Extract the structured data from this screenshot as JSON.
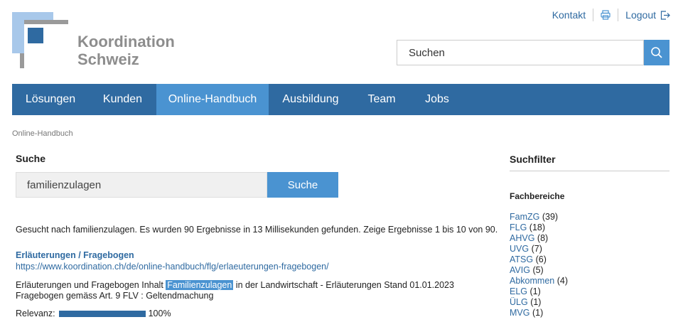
{
  "header": {
    "logo_line1": "Koordination",
    "logo_line2": "Schweiz",
    "links": {
      "kontakt": "Kontakt",
      "logout": "Logout"
    },
    "search_placeholder": "Suchen"
  },
  "nav": {
    "items": [
      {
        "label": "Lösungen",
        "active": false
      },
      {
        "label": "Kunden",
        "active": false
      },
      {
        "label": "Online-Handbuch",
        "active": true
      },
      {
        "label": "Ausbildung",
        "active": false
      },
      {
        "label": "Team",
        "active": false
      },
      {
        "label": "Jobs",
        "active": false
      }
    ]
  },
  "breadcrumb": "Online-Handbuch",
  "search": {
    "heading": "Suche",
    "query": "familienzulagen",
    "button": "Suche",
    "summary": "Gesucht nach familienzulagen. Es wurden 90 Ergebnisse in 13 Millisekunden gefunden. Zeige Ergebnisse 1 bis 10 von 90."
  },
  "results": [
    {
      "title": "Erläuterungen / Fragebogen",
      "url": "https://www.koordination.ch/de/online-handbuch/flg/erlaeuterungen-fragebogen/",
      "snippet_before": "Erläuterungen und Fragebogen Inhalt ",
      "snippet_highlight": "Familienzulagen",
      "snippet_after": " in der Landwirtschaft - Erläuterungen Stand 01.01.2023 Fragebogen gemäss Art. 9 FLV : Geltendmachung",
      "relevance_label": "Relevanz:",
      "relevance_text": "100%",
      "relevance_value": 1.0
    }
  ],
  "sidebar": {
    "heading": "Suchfilter",
    "subheading": "Fachbereiche",
    "filters": [
      {
        "name": "FamZG",
        "count": "(39)"
      },
      {
        "name": "FLG",
        "count": "(18)"
      },
      {
        "name": "AHVG",
        "count": "(8)"
      },
      {
        "name": "UVG",
        "count": "(7)"
      },
      {
        "name": "ATSG",
        "count": "(6)"
      },
      {
        "name": "AVIG",
        "count": "(5)"
      },
      {
        "name": "Abkommen",
        "count": "(4)"
      },
      {
        "name": "ELG",
        "count": "(1)"
      },
      {
        "name": "ÜLG",
        "count": "(1)"
      },
      {
        "name": "MVG",
        "count": "(1)"
      }
    ]
  },
  "colors": {
    "brand_dark": "#2f6aa1",
    "brand_light": "#4a93d1",
    "logo_grey": "#8d8d8d"
  }
}
